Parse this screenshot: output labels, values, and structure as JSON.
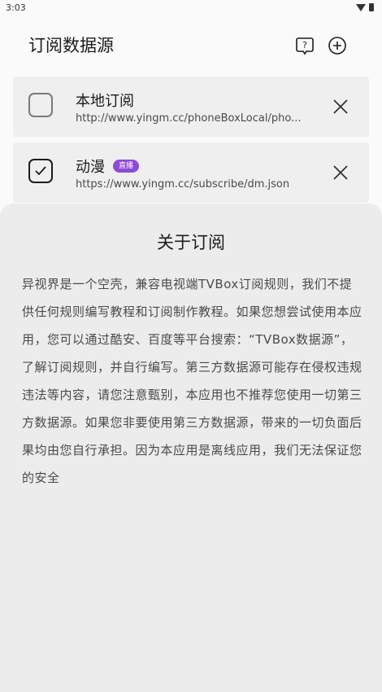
{
  "status": {
    "time": "3:03"
  },
  "header": {
    "title": "订阅数据源"
  },
  "subscriptions": [
    {
      "name": "本地订阅",
      "url": "http://www.yingm.cc/phoneBoxLocal/pho...",
      "checked": false,
      "badge": ""
    },
    {
      "name": "动漫",
      "url": "https://www.yingm.cc/subscribe/dm.json",
      "checked": true,
      "badge": "直播"
    }
  ],
  "sheet": {
    "title": "关于订阅",
    "body": "异视界是一个空壳，兼容电视端TVBox订阅规则，我们不提供任何规则编写教程和订阅制作教程。如果您想尝试使用本应用，您可以通过酷安、百度等平台搜索：“TVBox数据源”，了解订阅规则，并自行编写。第三方数据源可能存在侵权违规违法等内容，请您注意甄别，本应用也不推荐您使用一切第三方数据源。如果您非要使用第三方数据源，带来的一切负面后果均由您自行承担。因为本应用是离线应用，我们无法保证您的安全"
  },
  "colors": {
    "accent": "#8e4bd9",
    "card": "#efefef",
    "sheet": "#ececec"
  }
}
